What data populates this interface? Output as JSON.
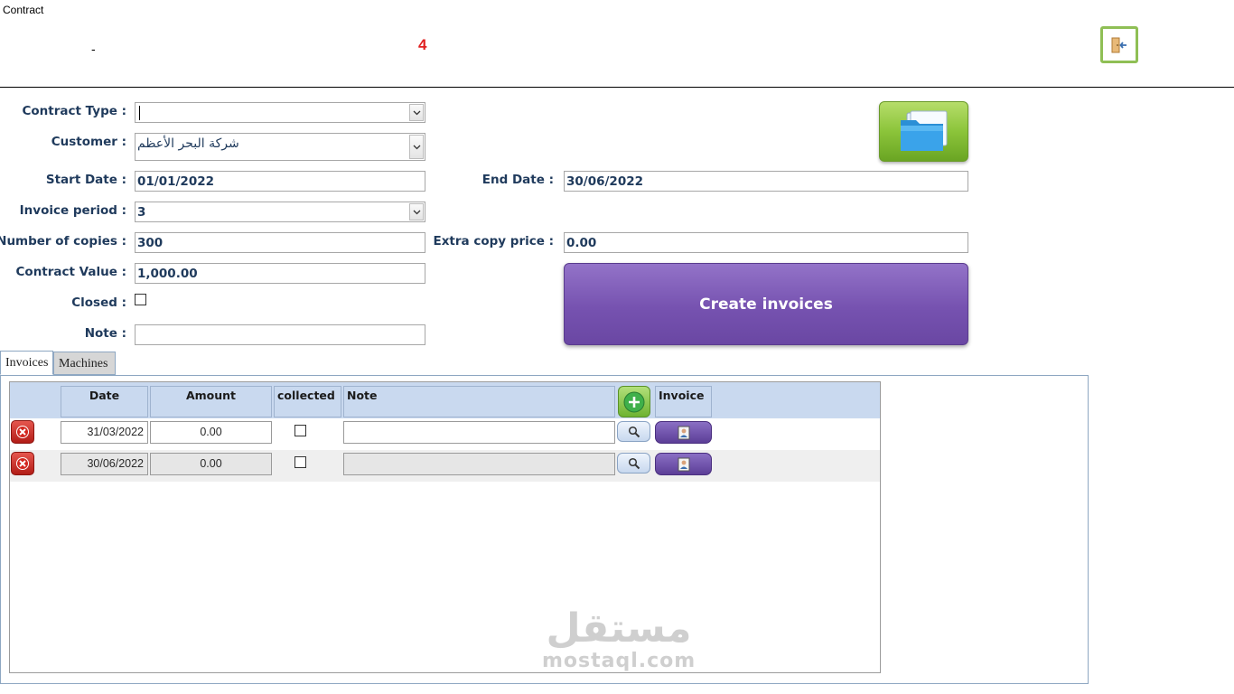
{
  "window": {
    "title": "Contract",
    "dash": "-",
    "record_number": "4"
  },
  "icons": {
    "exit": "exit-door-icon",
    "folder": "folder-icon",
    "combo_arrow": "chevron-down-icon",
    "delete": "close-icon",
    "search": "search-icon",
    "invoice": "contact-card-icon",
    "add": "plus-icon"
  },
  "form": {
    "contract_type": {
      "label": "Contract Type :",
      "value": ""
    },
    "customer": {
      "label": "Customer :",
      "value": "شركة البحر الأعظم"
    },
    "start_date": {
      "label": "Start Date :",
      "value": "01/01/2022"
    },
    "end_date": {
      "label": "End Date :",
      "value": "30/06/2022"
    },
    "invoice_period": {
      "label": "Invoice period :",
      "value": "3"
    },
    "number_of_copies": {
      "label": "Number of copies :",
      "value": "300"
    },
    "extra_copy_price": {
      "label": "Extra copy price :",
      "value": "0.00"
    },
    "contract_value": {
      "label": "Contract Value :",
      "value": "1,000.00"
    },
    "closed": {
      "label": "Closed :",
      "checked": false
    },
    "note": {
      "label": "Note :",
      "value": ""
    }
  },
  "actions": {
    "create_invoices": "Create invoices"
  },
  "tabs": [
    {
      "label": "Invoices",
      "active": true
    },
    {
      "label": "Machines",
      "active": false
    }
  ],
  "invoices_grid": {
    "columns": {
      "date": "Date",
      "amount": "Amount",
      "collected": "collected",
      "note": "Note",
      "invoice": "Invoice"
    },
    "rows": [
      {
        "date": "31/03/2022",
        "amount": "0.00",
        "collected": false,
        "note": ""
      },
      {
        "date": "30/06/2022",
        "amount": "0.00",
        "collected": false,
        "note": ""
      }
    ]
  },
  "watermark": {
    "arabic": "مستقل",
    "latin": "mostaql.com"
  },
  "colors": {
    "label_text": "#1f3a5c",
    "record_number": "#e02020",
    "create_button": "#7652b0",
    "folder_button": "#8bc43a",
    "grid_header": "#c9d9ef",
    "delete_button": "#c62a22"
  }
}
